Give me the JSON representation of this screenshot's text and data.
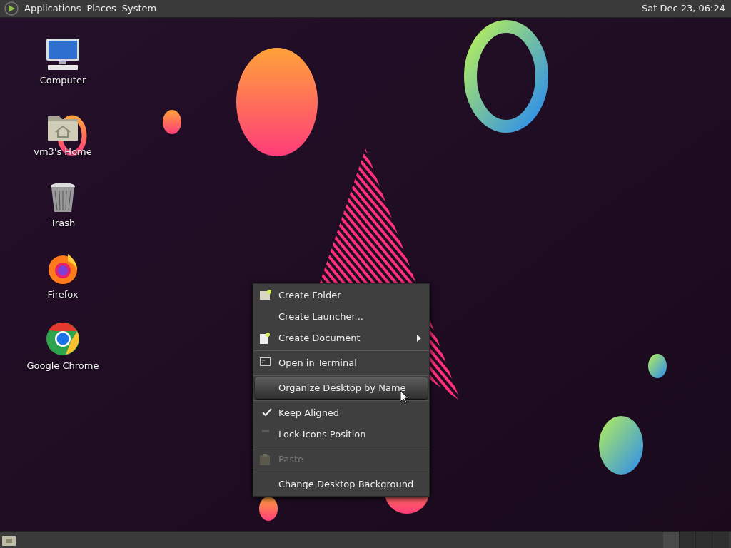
{
  "top_panel": {
    "menus": [
      "Applications",
      "Places",
      "System"
    ],
    "clock": "Sat Dec 23, 06:24"
  },
  "desktop_icons": [
    {
      "label": "Computer"
    },
    {
      "label": "vm3's Home"
    },
    {
      "label": "Trash"
    },
    {
      "label": "Firefox"
    },
    {
      "label": "Google Chrome"
    }
  ],
  "context_menu": {
    "items": [
      {
        "kind": "action",
        "label": "Create Folder",
        "selected": false,
        "disabled": false,
        "submenu": false
      },
      {
        "kind": "action",
        "label": "Create Launcher...",
        "selected": false,
        "disabled": false,
        "submenu": false
      },
      {
        "kind": "action",
        "label": "Create Document",
        "selected": false,
        "disabled": false,
        "submenu": true
      },
      {
        "kind": "separator"
      },
      {
        "kind": "action",
        "label": "Open in Terminal",
        "selected": false,
        "disabled": false,
        "submenu": false
      },
      {
        "kind": "separator"
      },
      {
        "kind": "action",
        "label": "Organize Desktop by Name",
        "selected": true,
        "disabled": false,
        "submenu": false
      },
      {
        "kind": "separator"
      },
      {
        "kind": "toggle",
        "label": "Keep Aligned",
        "checked": true,
        "selected": false,
        "disabled": false
      },
      {
        "kind": "toggle",
        "label": "Lock Icons Position",
        "checked": false,
        "selected": false,
        "disabled": false
      },
      {
        "kind": "separator"
      },
      {
        "kind": "action",
        "label": "Paste",
        "selected": false,
        "disabled": true,
        "submenu": false
      },
      {
        "kind": "separator"
      },
      {
        "kind": "action",
        "label": "Change Desktop Background",
        "selected": false,
        "disabled": false,
        "submenu": false
      }
    ]
  }
}
